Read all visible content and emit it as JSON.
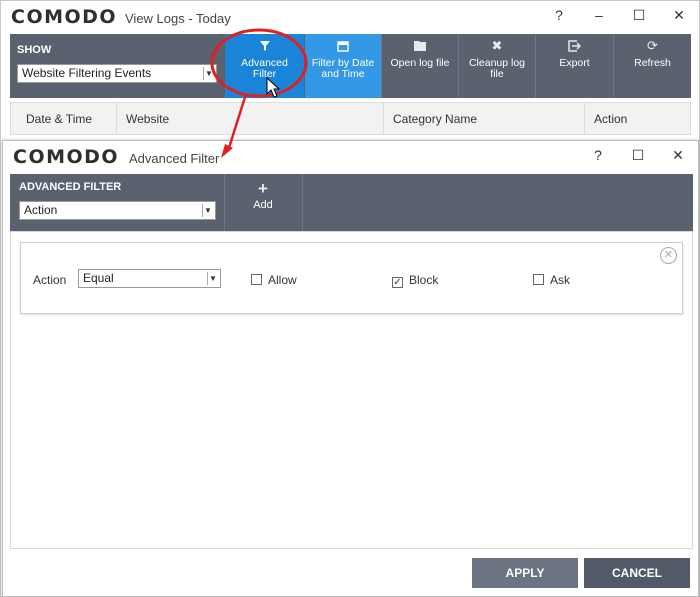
{
  "main_window": {
    "logo": "COMODO",
    "title": "View Logs - Today",
    "controls": {
      "help": "?",
      "minimize": "–",
      "maximize": "☐",
      "close": "✕"
    },
    "toolbar": {
      "show_label": "SHOW",
      "show_value": "Website Filtering Events",
      "buttons": [
        {
          "label_line1": "Advanced",
          "label_line2": "Filter",
          "icon": "funnel-icon"
        },
        {
          "label_line1": "Filter by Date",
          "label_line2": "and Time",
          "icon": "calendar-icon"
        },
        {
          "label_line1": "Open log file",
          "label_line2": "",
          "icon": "folder-icon"
        },
        {
          "label_line1": "Cleanup log",
          "label_line2": "file",
          "icon": "x-icon"
        },
        {
          "label_line1": "Export",
          "label_line2": "",
          "icon": "export-icon"
        },
        {
          "label_line1": "Refresh",
          "label_line2": "",
          "icon": "refresh-icon"
        }
      ]
    },
    "columns": [
      "Date & Time",
      "Website",
      "Category Name",
      "Action"
    ]
  },
  "filter_dialog": {
    "logo": "COMODO",
    "title": "Advanced Filter",
    "controls": {
      "help": "?",
      "maximize": "☐",
      "close": "✕"
    },
    "bar": {
      "label": "ADVANCED FILTER",
      "select_value": "Action",
      "add_label": "Add"
    },
    "rule": {
      "label": "Action",
      "operator": "Equal",
      "options": [
        {
          "label": "Allow",
          "checked": false
        },
        {
          "label": "Block",
          "checked": true
        },
        {
          "label": "Ask",
          "checked": false
        }
      ]
    },
    "buttons": {
      "apply": "APPLY",
      "cancel": "CANCEL"
    }
  },
  "colors": {
    "toolbar_bg": "#5a6270",
    "active_button": "#1a84d9",
    "annotation_red": "#e02020"
  }
}
